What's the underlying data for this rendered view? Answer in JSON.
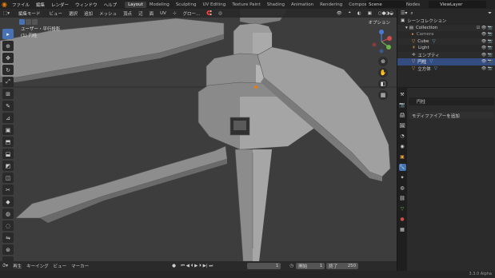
{
  "top_menu": {
    "items": [
      "ファイル",
      "編集",
      "レンダー",
      "ウィンドウ",
      "ヘルプ"
    ],
    "workspace_tabs": [
      "Layout",
      "Modeling",
      "Sculpting",
      "UV Editing",
      "Texture Paint",
      "Shading",
      "Animation",
      "Rendering",
      "Compositing",
      "Geometry Nodes"
    ],
    "active_tab": "Layout",
    "scene": "Scene",
    "view_layer": "ViewLayer"
  },
  "viewport": {
    "mode": "編集モード",
    "menus": [
      "ビュー",
      "選択",
      "追加",
      "メッシュ",
      "頂点",
      "辺",
      "面",
      "UV"
    ],
    "transform_orientation": "グロー...",
    "info_line1": "ユーザー・平行投影",
    "info_line2": "(1) 円柱",
    "overlay_label": "オプション"
  },
  "outliner": {
    "title": "シーンコレクション",
    "rows": [
      {
        "name": "Collection",
        "color": "#ffffff"
      },
      {
        "name": "Camera",
        "color": "#e08a4a"
      },
      {
        "name": "Cube",
        "color": "#e8a040"
      },
      {
        "name": "Light",
        "color": "#e0a040"
      },
      {
        "name": "エンプティ",
        "color": "#d0d0d0"
      },
      {
        "name": "円柱",
        "color": "#e8a040"
      },
      {
        "name": "立方体",
        "color": "#e8a040"
      }
    ]
  },
  "properties": {
    "object_name": "円柱",
    "add_modifier": "モディファイアーを追加"
  },
  "timeline": {
    "menus": [
      "再生",
      "キーイング",
      "ビュー",
      "マーカー"
    ],
    "current_frame": "1",
    "start_label": "開始",
    "start": "1",
    "end_label": "終了",
    "end": "250"
  },
  "status": {
    "version": "3.3.0 Alpha"
  },
  "colors": {
    "accent": "#4772b3",
    "selection": "#334d80",
    "viewport_bg": "#3d3d3d"
  }
}
